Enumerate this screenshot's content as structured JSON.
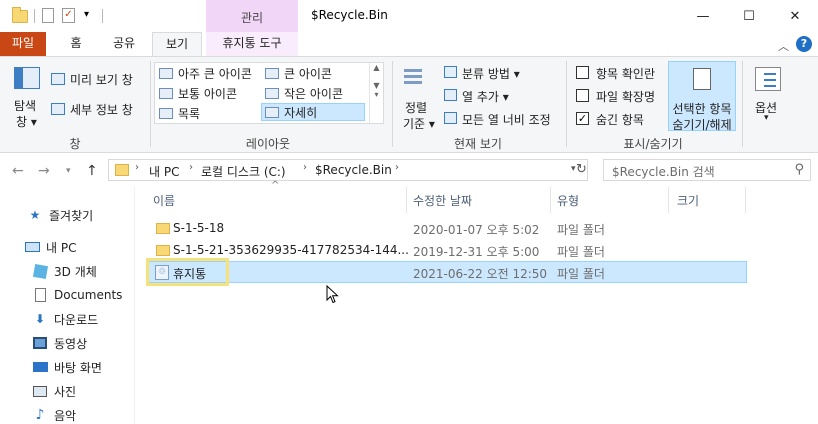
{
  "window": {
    "title": "$Recycle.Bin",
    "contextual_tab_group": "관리",
    "buttons": {
      "minimize": "—",
      "maximize": "☐",
      "close": "✕"
    }
  },
  "ribbon_tabs": [
    {
      "label": "파일"
    },
    {
      "label": "홈"
    },
    {
      "label": "공유"
    },
    {
      "label": "보기"
    },
    {
      "label": "휴지통 도구"
    }
  ],
  "ribbon": {
    "panes": {
      "nav_pane_label": "탐색",
      "nav_pane_label2": "창",
      "preview_pane": "미리 보기 창",
      "details_pane": "세부 정보 창",
      "group_label": "창"
    },
    "layout": {
      "items": [
        {
          "label": "아주 큰 아이콘"
        },
        {
          "label": "큰 아이콘"
        },
        {
          "label": "보통 아이콘"
        },
        {
          "label": "작은 아이콘"
        },
        {
          "label": "목록"
        },
        {
          "label": "자세히"
        }
      ],
      "group_label": "레이아웃"
    },
    "current_view": {
      "sort_label": "정렬",
      "sort_label2": "기준",
      "group_by": "분류 방법",
      "add_columns": "열 추가",
      "fit_columns": "모든 열 너비 조정",
      "group_label": "현재 보기"
    },
    "show_hide": {
      "item_checkboxes": "항목 확인란",
      "file_extensions": "파일 확장명",
      "hidden_items": "숨긴 항목",
      "hide_selected_line1": "선택한 항목",
      "hide_selected_line2": "숨기기/해제",
      "group_label": "표시/숨기기",
      "checked": {
        "item_checkboxes": false,
        "file_extensions": false,
        "hidden_items": true
      }
    },
    "options": {
      "label": "옵션"
    }
  },
  "address": {
    "segments": [
      "내 PC",
      "로컬 디스크 (C:)",
      "$Recycle.Bin"
    ],
    "search_placeholder": "$Recycle.Bin 검색"
  },
  "nav_pane": [
    {
      "label": "즐겨찾기",
      "icon": "star-icon"
    },
    {
      "label": "내 PC",
      "icon": "pc-icon"
    },
    {
      "label": "3D 개체",
      "icon": "cube-icon"
    },
    {
      "label": "Documents",
      "icon": "document-icon"
    },
    {
      "label": "다운로드",
      "icon": "download-icon"
    },
    {
      "label": "동영상",
      "icon": "video-icon"
    },
    {
      "label": "바탕 화면",
      "icon": "desktop-icon"
    },
    {
      "label": "사진",
      "icon": "picture-icon"
    },
    {
      "label": "음악",
      "icon": "music-icon"
    }
  ],
  "columns": [
    "이름",
    "수정한 날짜",
    "유형",
    "크기"
  ],
  "files": [
    {
      "name": "S-1-5-18",
      "date": "2020-01-07 오후 5:02",
      "type": "파일 폴더",
      "icon": "folder-icon"
    },
    {
      "name": "S-1-5-21-353629935-417782534-144...",
      "date": "2019-12-31 오후 5:00",
      "type": "파일 폴더",
      "icon": "folder-icon"
    },
    {
      "name": "휴지통",
      "date": "2021-06-22 오전 12:50",
      "type": "파일 폴더",
      "icon": "recycle-bin-icon",
      "selected": true
    }
  ]
}
